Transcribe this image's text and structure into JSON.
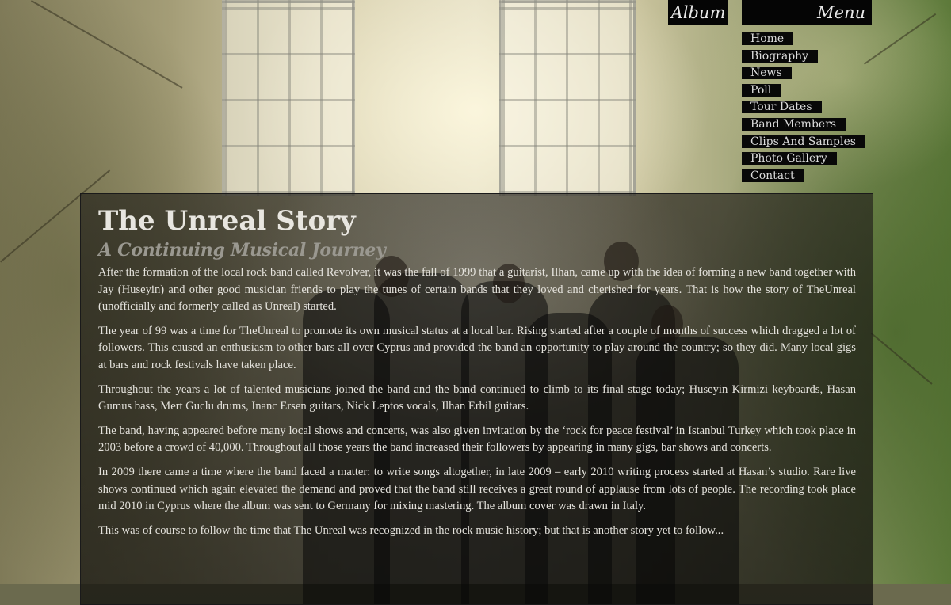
{
  "nav": {
    "album_label": "Album",
    "menu_label": "Menu",
    "items": [
      {
        "label": "Home"
      },
      {
        "label": "Biography"
      },
      {
        "label": "News"
      },
      {
        "label": "Poll"
      },
      {
        "label": "Tour Dates"
      },
      {
        "label": "Band Members"
      },
      {
        "label": "Clips And Samples"
      },
      {
        "label": "Photo Gallery"
      },
      {
        "label": "Contact"
      }
    ]
  },
  "content": {
    "title": "The Unreal Story",
    "subtitle": "A Continuing Musical Journey",
    "paragraphs": [
      "After the formation of the local rock band called Revolver, it was the fall of 1999 that a guitarist, Ilhan, came up with the idea of forming a new band together with Jay (Huseyin) and other good musician friends to play the tunes of certain bands that they loved and cherished for years. That is how the story of TheUnreal (unofficially and formerly called as Unreal) started.",
      "The year of 99 was a time for TheUnreal to promote its own musical status at a local bar. Rising started after a couple of months of success which dragged a lot of followers. This caused an enthusiasm to other bars all over Cyprus and provided the band an opportunity to play around the country; so they did. Many local gigs at bars and rock festivals have taken place.",
      "Throughout the years a lot of talented musicians joined the band and the band continued to climb to its final stage today; Huseyin Kirmizi keyboards, Hasan Gumus bass, Mert Guclu drums, Inanc Ersen guitars, Nick Leptos vocals, Ilhan Erbil guitars.",
      "The band, having appeared before many local shows and concerts, was also given invitation by the ‘rock for peace festival’ in Istanbul Turkey which took place in 2003 before a crowd of 40,000. Throughout all those years the band increased their followers by appearing in many gigs, bar shows and concerts.",
      "In 2009 there came a time where the band faced a matter: to write songs altogether, in late 2009 – early 2010 writing process started at Hasan’s studio. Rare live shows continued which again elevated the demand and proved that the band still receives a great round of applause from lots of people. The recording took place mid 2010 in Cyprus where the album was sent to Germany for mixing mastering. The album cover was drawn in Italy.",
      "This was of course to follow the time that The Unreal was recognized in the rock music history; but that is another story yet to follow..."
    ]
  }
}
